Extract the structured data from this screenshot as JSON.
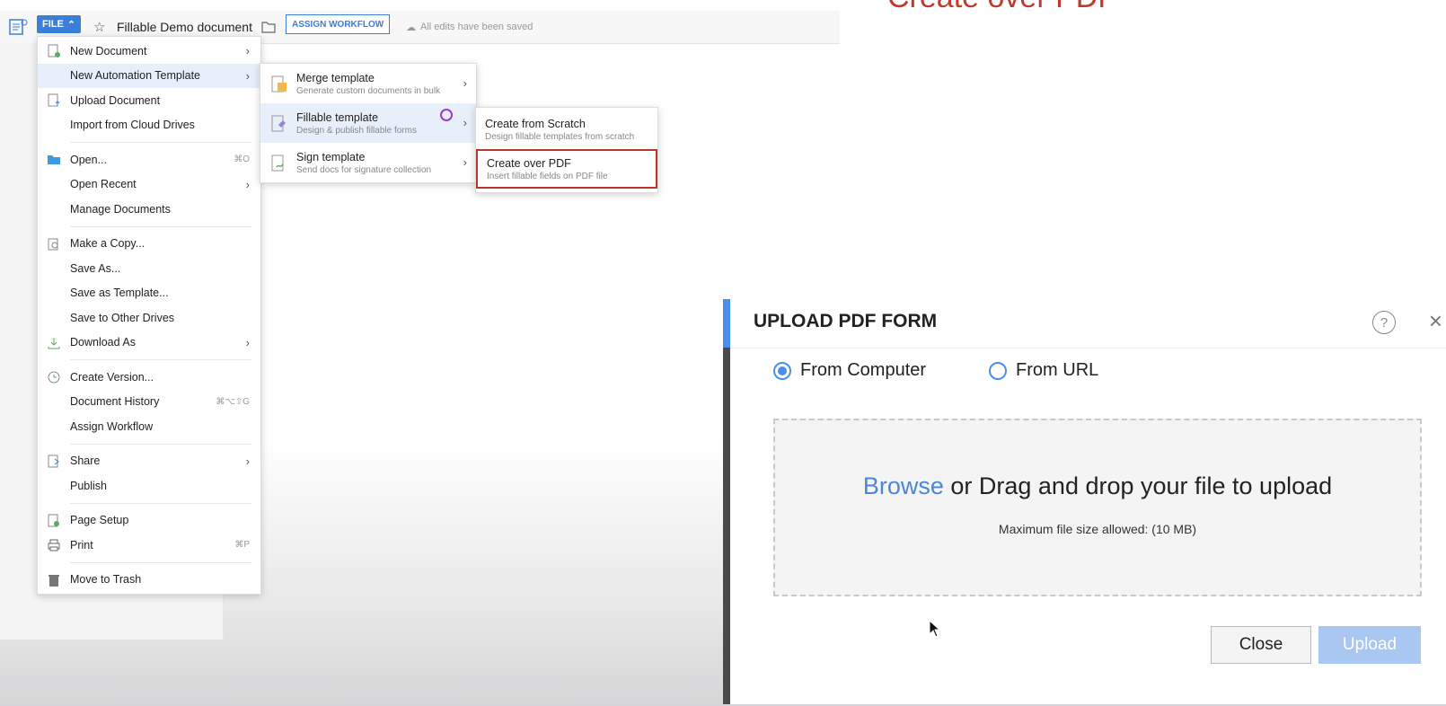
{
  "caption": "Create over PDF",
  "toolbar": {
    "file_label": "FILE",
    "doc_title": "Fillable Demo document",
    "assign_label": "ASSIGN WORKFLOW",
    "saved_text": "All edits have been saved"
  },
  "file_menu": {
    "items": [
      {
        "label": "New Document",
        "icon": "new-doc-icon",
        "arrow": true
      },
      {
        "label": "New Automation Template",
        "arrow": true,
        "active": true
      },
      {
        "label": "Upload Document",
        "icon": "upload-doc-icon"
      },
      {
        "label": "Import from Cloud Drives"
      },
      {
        "label": "Open...",
        "icon": "folder-open-icon",
        "shortcut": "⌘O"
      },
      {
        "label": "Open Recent",
        "arrow": true
      },
      {
        "label": "Manage Documents"
      },
      {
        "label": "Make a Copy...",
        "icon": "copy-icon"
      },
      {
        "label": "Save As..."
      },
      {
        "label": "Save as Template..."
      },
      {
        "label": "Save to Other Drives"
      },
      {
        "label": "Download As",
        "icon": "download-icon",
        "arrow": true
      },
      {
        "label": "Create Version...",
        "icon": "version-icon"
      },
      {
        "label": "Document History",
        "shortcut": "⌘⌥⇧G"
      },
      {
        "label": "Assign Workflow"
      },
      {
        "label": "Share",
        "icon": "share-icon",
        "arrow": true
      },
      {
        "label": "Publish"
      },
      {
        "label": "Page Setup",
        "icon": "page-setup-icon"
      },
      {
        "label": "Print",
        "icon": "print-icon",
        "shortcut": "⌘P"
      },
      {
        "label": "Move to Trash",
        "icon": "trash-icon"
      }
    ]
  },
  "automation_submenu": [
    {
      "title": "Merge template",
      "desc": "Generate custom documents in bulk"
    },
    {
      "title": "Fillable template",
      "desc": "Design & publish fillable forms",
      "active": true
    },
    {
      "title": "Sign template",
      "desc": "Send docs for signature collection"
    }
  ],
  "fillable_submenu": [
    {
      "title": "Create from Scratch",
      "desc": "Design fillable templates from scratch"
    },
    {
      "title": "Create over PDF",
      "desc": "Insert fillable fields on PDF file",
      "highlighted": true
    }
  ],
  "dialog": {
    "title": "UPLOAD PDF FORM",
    "help": "?",
    "close": "×",
    "radio_computer": "From Computer",
    "radio_url": "From URL",
    "browse": "Browse",
    "drop_text": " or Drag and drop your file to upload",
    "max_size": "Maximum file size allowed: (10 MB)",
    "close_button": "Close",
    "upload_button": "Upload"
  },
  "colors": {
    "accent": "#3b7fd9",
    "highlight_border": "#b9362d",
    "radio": "#4a8ef0"
  }
}
